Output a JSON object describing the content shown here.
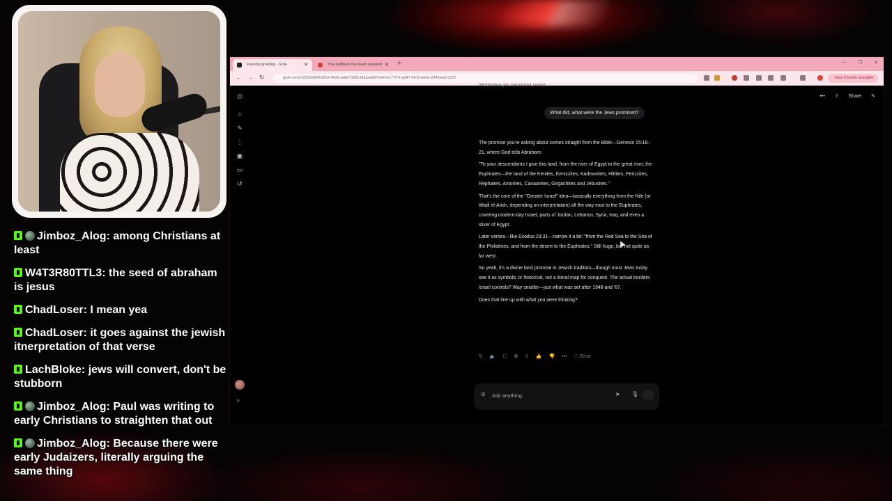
{
  "chat": {
    "messages": [
      {
        "user": "Jimboz_Alog",
        "text": "among Christians at least",
        "badge": "globe"
      },
      {
        "user": "W4T3R80TTL3",
        "text": "the seed of abraham is jesus",
        "badge": ""
      },
      {
        "user": "ChadLoser",
        "text": "I mean yea",
        "badge": ""
      },
      {
        "user": "ChadLoser",
        "text": "it goes against the jewish itnerpretation of that verse",
        "badge": ""
      },
      {
        "user": "LachBloke",
        "text": "jews will convert, don't be stubborn",
        "badge": ""
      },
      {
        "user": "Jimboz_Alog",
        "text": "Paul was writing to early Christians to straighten that out",
        "badge": "globe"
      },
      {
        "user": "Jimboz_Alog",
        "text": "Because there were early Judaizers, literally arguing the same thing",
        "badge": "globe"
      }
    ]
  },
  "browser": {
    "tabs": [
      {
        "title": "Friendly greeting - Grok",
        "active": true
      },
      {
        "title": "Your AdBlock has been updated",
        "active": false
      }
    ],
    "url": "grok.com/c/2031e800-b5b2-492b-add2-58d13d3aadb6?rid=16c7757f-a247-4611-8a5e-2841bab72227",
    "update_label": "New Chrome available",
    "accent": "#f3a9b8"
  },
  "grok": {
    "share_label": "Share",
    "previous_snippet": "information you remember seems",
    "user_message": "What did, what were the Jews promised?",
    "answer": [
      "The promise you're asking about comes straight from the Bible—Genesis 15:18–21, where God tells Abraham:",
      "\"To your descendants I give this land, from the river of Egypt to the great river, the Euphrates—the land of the Kenites, Kenizzites, Kadmonites, Hittites, Perizzites, Rephaites, Amorites, Canaanites, Girgashites and Jebusites.\"",
      "That's the core of the \"Greater Israel\" idea—basically everything from the Nile (or Wadi el-Arish, depending on interpretation) all the way east to the Euphrates, covering modern-day Israel, parts of Jordan, Lebanon, Syria, Iraq, and even a sliver of Egypt.",
      "Later verses—like Exodus 23:31—narrow it a bit: \"from the Red Sea to the Sea of the Philistines, and from the desert to the Euphrates.\" Still huge, but not quite as far west.",
      "So yeah, it's a divine land promise in Jewish tradition—though most Jews today see it as symbolic or historical, not a literal map for conquest. The actual borders Israel controls? Way smaller—just what was set after 1948 and '67.",
      "Does that line up with what you were thinking?"
    ],
    "error_label": "Error",
    "composer_placeholder": "Ask anything"
  }
}
